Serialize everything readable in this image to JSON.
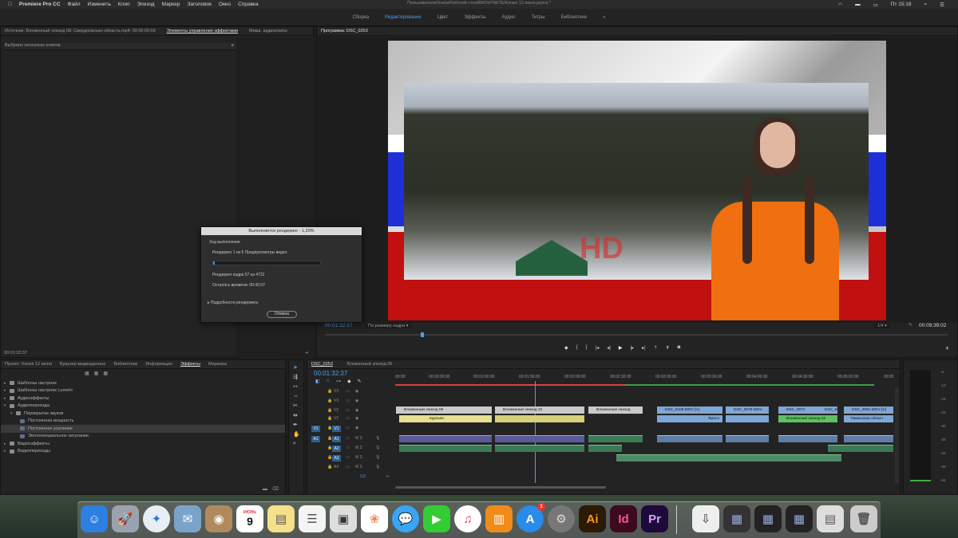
{
  "menubar": {
    "app_name": "Premiere Pro CC",
    "items": [
      "Файл",
      "Изменить",
      "Клип",
      "Эпизод",
      "Маркер",
      "Заголовок",
      "Окно",
      "Справка"
    ],
    "document_title": "Пользователи/Sveta/Рабочий стол/ВКОНТАКТЕ/Копия 12 июня.prproj *",
    "clock": "Пт 15:18"
  },
  "workspaces": [
    "Сборка",
    "Редактирование",
    "Цвет",
    "Эффекты",
    "Аудио",
    "Титры",
    "Библиотеки"
  ],
  "workspaces_active": "Редактирование",
  "source_panel": {
    "tabs": [
      "Источник: Вложенный эпизод 08: Свердловская область.mp4: 00:00:00:00",
      "Элементы управления эффектами",
      "Микш. аудиоклипа:"
    ],
    "active_tab": "Элементы управления эффектами",
    "selection_label": "Выбрано несколько клипов",
    "timecode": "00:01:32:37"
  },
  "program_monitor": {
    "tab": "Программа: DSC_0253",
    "timecode": "00:01:32:37",
    "fit": "По размеру кадра",
    "resolution": "1/4",
    "duration": "00:09:39:02",
    "watermark": "HD"
  },
  "render_dialog": {
    "title": "Выполняется рендеринг : 1,20%",
    "group_label": "Ход выполнения",
    "line1": "Рендеринг 1 из 6 Предпросмотры видео",
    "progress_fraction": 0.012,
    "line2": "Рендеринг кадра 57 из 4722",
    "line3": "Осталось времени: 00:42:07",
    "details": "Подробности рендеринга",
    "cancel": "Отмена"
  },
  "project_panel": {
    "tabs": [
      "Проект: Копия 12 июня",
      "Браузер медиаданных",
      "Библиотеки",
      "Информация",
      "Эффекты",
      "Маркеры"
    ],
    "active_tab": "Эффекты",
    "tree": [
      {
        "label": "Шаблоны настроек",
        "level": 0
      },
      {
        "label": "Шаблоны настроек Lumetri",
        "level": 0
      },
      {
        "label": "Аудиоэффекты",
        "level": 0
      },
      {
        "label": "Аудиопереходы",
        "level": 0
      },
      {
        "label": "Перекрытие звуков",
        "level": 1
      },
      {
        "label": "Постоянная мощность",
        "level": 2
      },
      {
        "label": "Постоянное усиление",
        "level": 2,
        "selected": true
      },
      {
        "label": "Экспоненциальное затухание",
        "level": 2
      },
      {
        "label": "Видеоэффекты",
        "level": 0
      },
      {
        "label": "Видеопереходы",
        "level": 0
      }
    ]
  },
  "timeline": {
    "tabs": [
      "DSC_0253",
      "Вложенный эпизод 06"
    ],
    "timecode": "00:01:32:37",
    "ruler": [
      "00:00",
      "00:00:30:00",
      "00:01:00:00",
      "00:01:30:00",
      "00:02:00:00",
      "00:02:30:00",
      "00:03:00:00",
      "00:03:30:00",
      "00:04:00:00",
      "00:04:30:00",
      "00:05:00:00",
      "00:05"
    ],
    "video_tracks": [
      "V3",
      "V2",
      "V1"
    ],
    "audio_tracks": [
      "A1",
      "A2",
      "A3",
      "A4"
    ],
    "master_value": "0,0",
    "clips": [
      {
        "label": "Вложенный эпизод 05",
        "color": "grey"
      },
      {
        "label": "Вложенный эпизод 10",
        "color": "grey"
      },
      {
        "label": "Вложенный эпизод",
        "color": "grey"
      },
      {
        "label": "DSC_0109.MOV [V]",
        "color": "blue"
      },
      {
        "label": "DSC_0079.MOV",
        "color": "blue"
      },
      {
        "label": "DSC_0071",
        "color": "blue"
      },
      {
        "label": "DSC_00",
        "color": "blue"
      },
      {
        "label": "DSC_0091.MOV [V]",
        "color": "blue"
      },
      {
        "label": "Курская",
        "color": "yellow"
      },
      {
        "label": "Яросл",
        "color": "yellow"
      },
      {
        "label": "Вложенный эпизод 02",
        "color": "green"
      },
      {
        "label": "Тюменская област",
        "color": "green"
      }
    ]
  },
  "audio_meter": {
    "ticks": [
      "-6",
      "-12",
      "-18",
      "-24",
      "-30",
      "-36",
      "-42",
      "-48",
      "-54"
    ]
  },
  "dock_apps": [
    "Finder",
    "Launchpad",
    "Safari",
    "Mail",
    "Contacts",
    "Calendar",
    "Notes",
    "Reminders",
    "Photo Booth",
    "Photos",
    "Messages",
    "FaceTime",
    "iTunes",
    "iBooks",
    "App Store",
    "System Preferences",
    "Illustrator",
    "InDesign",
    "Premiere Pro"
  ],
  "calendar_day": "9",
  "calendar_month": "ИЮНЬ",
  "appstore_badge": "1"
}
